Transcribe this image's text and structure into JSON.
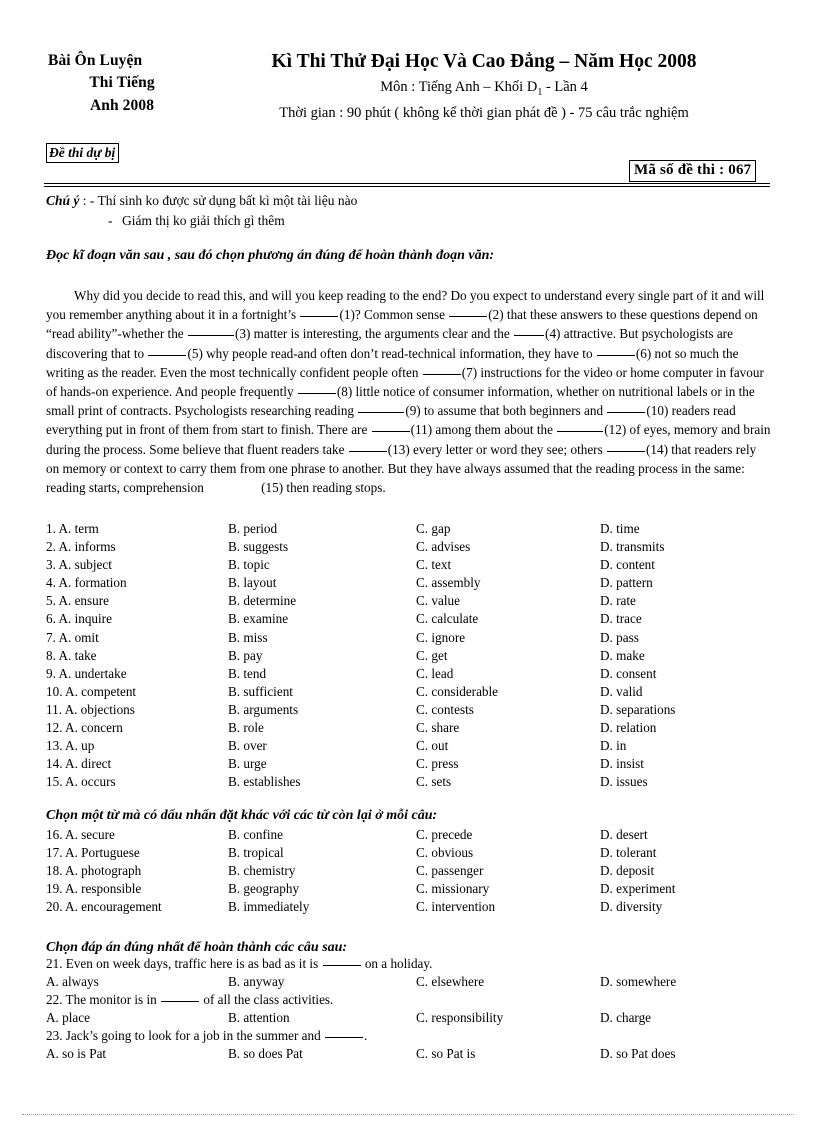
{
  "header": {
    "left_lines": [
      "Bài Ôn Luyện",
      "Thi Tiếng",
      "Anh 2008"
    ],
    "exam_title": "Kì Thi Thử Đại Học Và Cao Đẳng – Năm Học 2008",
    "subject_prefix": "Môn : Tiếng Anh – Khối D",
    "subject_subscript": "1",
    "subject_suffix": " - Lần 4",
    "duration_line": "Thời gian : 90 phút ( không kể thời gian phát đề ) - 75 câu trắc nghiệm",
    "reserve_badge": "Đề thi dự bị",
    "exam_code_badge": "Mã số đề thi : 067"
  },
  "note": {
    "label": "Chú ý",
    "line1": " : - Thí sinh ko được sử dụng bất kì một tài liệu nào",
    "line2": "Giám thị ko giải thích gì thêm"
  },
  "sections": {
    "heading_cloze": "Đọc kĩ đoạn văn sau , sau đó chọn phương án đúng để hoàn thành đoạn văn:",
    "heading_stress": "Chọn một từ mà có dấu nhấn đặt khác với các từ còn lại ở mỗi câu:",
    "heading_sentence": "Chọn đáp án đúng nhất để hoàn thành các câu sau:"
  },
  "passage": {
    "seg1": "Why did you decide to read this, and will you keep reading to the end? Do you expect to understand every single part of it and will you remember anything about it in a fortnight’s ",
    "n1": "(1)? Common sense ",
    "n2": "(2) that these answers to these questions depend on “read ability”-whether the ",
    "n3": "(3) matter is interesting, the arguments clear and the ",
    "n4": "(4) attractive. But psychologists are discovering that to ",
    "n5": "(5) why people read-and often don’t read-technical information, they have to ",
    "n6": "(6) not so much the writing as the reader. Even the most technically confident people often ",
    "n7": "(7) instructions for the video or home computer in favour of hands-on experience. And people frequently ",
    "n8": "(8) little notice of consumer information, whether on nutritional labels or in the small print of contracts. Psychologists researching reading ",
    "n9": "(9) to assume that both beginners and ",
    "n10": "(10) readers read everything put in front of them from start to finish. There are ",
    "n11": "(11) among them about the ",
    "n12": "(12) of eyes, memory and brain during the process. Some believe that fluent readers take ",
    "n13": "(13) every letter or word they see; others ",
    "n14": "(14) that readers rely on memory or context to carry them from one phrase to another. But they have always assumed that the reading process in the same: reading starts, comprehension ",
    "n15": "(15) then reading stops."
  },
  "cloze_questions": [
    {
      "num": "1.",
      "a": "A. term",
      "b": "B. period",
      "c": "C. gap",
      "d": "D. time"
    },
    {
      "num": "2.",
      "a": "A. informs",
      "b": "B. suggests",
      "c": "C. advises",
      "d": "D. transmits"
    },
    {
      "num": "3.",
      "a": "A. subject",
      "b": "B. topic",
      "c": "C. text",
      "d": "D. content"
    },
    {
      "num": "4.",
      "a": "A. formation",
      "b": "B. layout",
      "c": "C. assembly",
      "d": "D. pattern"
    },
    {
      "num": "5.",
      "a": "A. ensure",
      "b": "B. determine",
      "c": "C. value",
      "d": "D. rate"
    },
    {
      "num": "6.",
      "a": "A. inquire",
      "b": "B. examine",
      "c": "C. calculate",
      "d": "D. trace"
    },
    {
      "num": "7.",
      "a": "A. omit",
      "b": "B. miss",
      "c": "C. ignore",
      "d": "D. pass"
    },
    {
      "num": "8.",
      "a": "A. take",
      "b": "B. pay",
      "c": "C. get",
      "d": "D. make"
    },
    {
      "num": "9.",
      "a": "A. undertake",
      "b": "B. tend",
      "c": "C. lead",
      "d": "D. consent"
    },
    {
      "num": "10.",
      "a": "A. competent",
      "b": "B. sufficient",
      "c": "C. considerable",
      "d": "D. valid"
    },
    {
      "num": "11.",
      "a": "A. objections",
      "b": "B. arguments",
      "c": "C. contests",
      "d": "D. separations"
    },
    {
      "num": "12.",
      "a": "A. concern",
      "b": "B. role",
      "c": "C. share",
      "d": "D. relation"
    },
    {
      "num": "13.",
      "a": "A. up",
      "b": "B. over",
      "c": "C. out",
      "d": "D. in"
    },
    {
      "num": "14.",
      "a": "A. direct",
      "b": "B. urge",
      "c": "C. press",
      "d": "D. insist"
    },
    {
      "num": "15.",
      "a": "A. occurs",
      "b": "B. establishes",
      "c": "C. sets",
      "d": "D. issues"
    }
  ],
  "stress_questions": [
    {
      "num": "16.",
      "a": "A. secure",
      "b": "B. confine",
      "c": "C. precede",
      "d": "D. desert"
    },
    {
      "num": "17.",
      "a": "A. Portuguese",
      "b": "B. tropical",
      "c": "C. obvious",
      "d": "D. tolerant"
    },
    {
      "num": "18.",
      "a": "A. photograph",
      "b": "B. chemistry",
      "c": "C. passenger",
      "d": "D. deposit"
    },
    {
      "num": "19.",
      "a": "A. responsible",
      "b": "B. geography",
      "c": "C. missionary",
      "d": "D. experiment"
    },
    {
      "num": "20.",
      "a": "A. encouragement",
      "b": "B. immediately",
      "c": "C. intervention",
      "d": "D. diversity"
    }
  ],
  "sentence_questions": [
    {
      "num": "21.",
      "stem_before": " Even on week days, traffic here is as bad as it is ",
      "stem_after": " on a holiday.",
      "a": "A. always",
      "b": "B. anyway",
      "c": "C. elsewhere",
      "d": "D. somewhere"
    },
    {
      "num": "22.",
      "stem_before": " The monitor is in ",
      "stem_after": " of all the class activities.",
      "a": "A. place",
      "b": "B. attention",
      "c": "C. responsibility",
      "d": "D. charge"
    },
    {
      "num": "23.",
      "stem_before": " Jack’s going to look for a job in the summer and ",
      "stem_after": ".",
      "a": "A. so is Pat",
      "b": "B. so does Pat",
      "c": "C. so Pat is",
      "d": "D. so Pat does"
    }
  ]
}
